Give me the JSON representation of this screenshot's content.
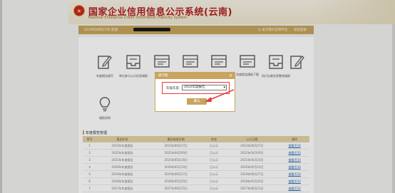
{
  "header": {
    "title": "国家企业信用信息公示系统(云南)",
    "subtitle": "National Enterprise Credit Information Publicity System",
    "emblem_glyph": "★"
  },
  "userbar": {
    "left_text": "2019年08月27日 星期",
    "right_item_1": "◎ 关于我们信用平台",
    "right_item_2": "退出登录"
  },
  "tiles": [
    {
      "label": "年度报告填写",
      "icon": "pencil-edit-icon"
    },
    {
      "label": "单位参与公示信息填报",
      "icon": "inbox-tray-icon"
    },
    {
      "label": "",
      "icon": "list-card-icon"
    },
    {
      "label": "",
      "icon": "list-card-icon"
    },
    {
      "label": "",
      "icon": "list-card-icon"
    },
    {
      "label": "年度报告模板下载",
      "icon": "list-card-icon"
    },
    {
      "label": "执行自查信息整改填报",
      "icon": "inbox-tray-icon"
    },
    {
      "label": "",
      "icon": "pencil-edit-icon"
    },
    {
      "label": "填报须知",
      "icon": "lightbulb-icon"
    }
  ],
  "section": {
    "title": "年度报告管理"
  },
  "table": {
    "headers": [
      "序号",
      "报告年份",
      "最近修改日期",
      "状态",
      "公示日期",
      "操作"
    ],
    "rows": [
      [
        "1",
        "2023年年度报告",
        "2023年06月27日",
        "已公示",
        "2023年06月27日",
        "查看/打印"
      ],
      [
        "2",
        "2022年年度报告",
        "2022年04月09日",
        "已公示",
        "2022年04月09日",
        "查看/打印"
      ],
      [
        "3",
        "2021年年度报告",
        "2021年05月16日",
        "已公示",
        "2021年05月16日",
        "查看/打印"
      ],
      [
        "4",
        "2020年年度报告",
        "2020年05月10日",
        "已公示",
        "2020年05月10日",
        "查看/打印"
      ],
      [
        "5",
        "2019年年度报告",
        "2019年06月27日",
        "已公示",
        "2019年06月27日",
        "查看/打印"
      ],
      [
        "6",
        "2018年年度报告",
        "2018年05月20日",
        "已公示",
        "2018年05月20日",
        "查看/打印"
      ],
      [
        "7",
        "2017年年度报告",
        "2017年06月15日",
        "已公示",
        "2017年06月15日",
        "查看/打印"
      ]
    ]
  },
  "dialog": {
    "title": "提示框",
    "close_glyph": "×",
    "label": "年报年度：",
    "select_value": "2022年度报告",
    "select_arrow": "▾",
    "confirm_label": "确认"
  },
  "colors": {
    "accent": "#c8a45f",
    "title_red": "#b22020",
    "highlight_red": "#e23a3a"
  }
}
